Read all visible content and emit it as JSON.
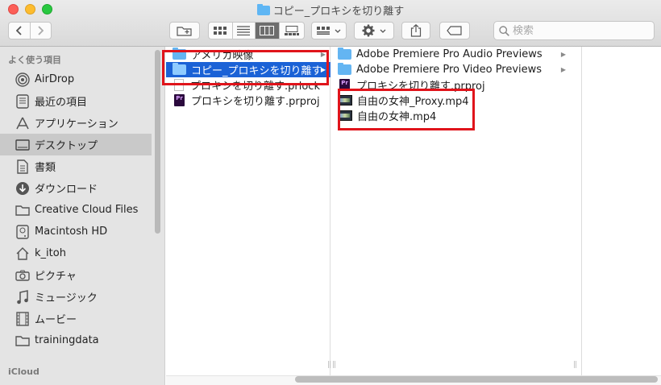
{
  "window": {
    "title": "コピー_プロキシを切り離す"
  },
  "toolbar": {
    "back_icon": "chevron-left-icon",
    "forward_icon": "chevron-right-icon",
    "search_placeholder": "検索"
  },
  "sidebar": {
    "favorites_header": "よく使う項目",
    "items": [
      {
        "label": "AirDrop",
        "icon": "airdrop-icon"
      },
      {
        "label": "最近の項目",
        "icon": "recents-icon"
      },
      {
        "label": "アプリケーション",
        "icon": "applications-icon"
      },
      {
        "label": "デスクトップ",
        "icon": "desktop-icon",
        "selected": true
      },
      {
        "label": "書類",
        "icon": "documents-icon"
      },
      {
        "label": "ダウンロード",
        "icon": "downloads-icon"
      },
      {
        "label": "Creative Cloud Files",
        "icon": "folder-icon"
      },
      {
        "label": "Macintosh HD",
        "icon": "hard-drive-icon"
      },
      {
        "label": "k_itoh",
        "icon": "home-icon"
      },
      {
        "label": "ピクチャ",
        "icon": "camera-icon"
      },
      {
        "label": "ミュージック",
        "icon": "music-icon"
      },
      {
        "label": "ムービー",
        "icon": "film-icon"
      },
      {
        "label": "trainingdata",
        "icon": "folder-icon"
      }
    ],
    "icloud_header": "iCloud"
  },
  "column1": {
    "items": [
      {
        "name": "アメリカ映像",
        "type": "folder"
      },
      {
        "name": "コピー_プロキシを切り離す",
        "type": "folder",
        "selected": true
      },
      {
        "name": "プロキシを切り離す.prlock",
        "type": "document"
      },
      {
        "name": "プロキシを切り離す.prproj",
        "type": "premiere-project"
      }
    ]
  },
  "column2": {
    "items": [
      {
        "name": "Adobe Premiere Pro Audio Previews",
        "type": "folder"
      },
      {
        "name": "Adobe Premiere Pro Video Previews",
        "type": "folder"
      },
      {
        "name": "プロキシを切り離す.prproj",
        "type": "premiere-project"
      },
      {
        "name": "自由の女神_Proxy.mp4",
        "type": "video"
      },
      {
        "name": "自由の女神.mp4",
        "type": "video"
      }
    ]
  },
  "colors": {
    "selection": "#1b62d6",
    "highlight_box": "#e0141b",
    "folder": "#64b5f2"
  }
}
